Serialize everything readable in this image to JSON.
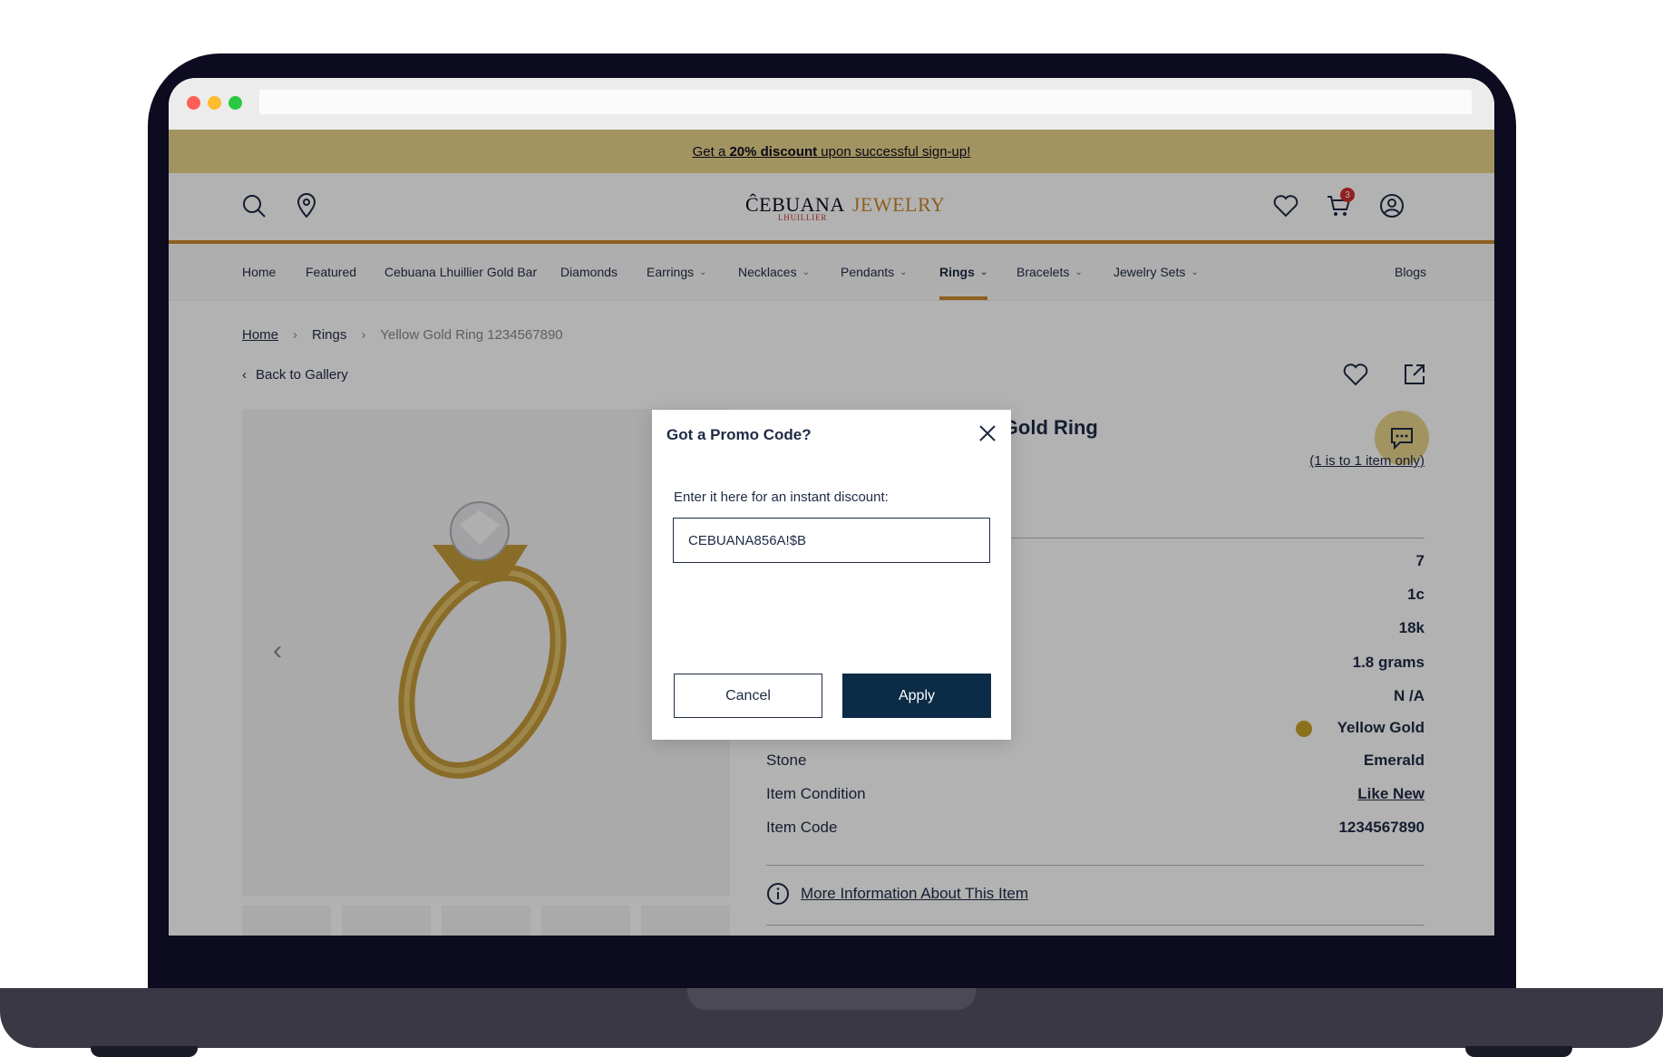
{
  "promo_bar": {
    "prefix": "Get a ",
    "highlight": "20% discount",
    "suffix": " upon successful sign-up!"
  },
  "logo": {
    "brand": "ĈEBUANA",
    "sub": "LHUILLIER",
    "product": "JEWELRY"
  },
  "cart": {
    "count": "3"
  },
  "nav": {
    "items": [
      {
        "label": "Home",
        "dropdown": false
      },
      {
        "label": "Featured",
        "dropdown": false
      },
      {
        "label": "Cebuana Lhuillier Gold Bar",
        "dropdown": false
      },
      {
        "label": "Diamonds",
        "dropdown": false
      },
      {
        "label": "Earrings",
        "dropdown": true
      },
      {
        "label": "Necklaces",
        "dropdown": true
      },
      {
        "label": "Pendants",
        "dropdown": true
      },
      {
        "label": "Rings",
        "dropdown": true,
        "active": true
      },
      {
        "label": "Bracelets",
        "dropdown": true
      },
      {
        "label": "Jewelry Sets",
        "dropdown": true
      }
    ],
    "blogs": "Blogs"
  },
  "breadcrumb": {
    "home": "Home",
    "category": "Rings",
    "current": "Yellow Gold Ring 1234567890"
  },
  "back_link": "Back to Gallery",
  "product": {
    "title_visible": "anite Engagement Yellow Gold Ring",
    "limit_note": "(1 is to 1 item only)",
    "specs_values": [
      "7",
      "1c",
      "18k",
      "1.8 grams",
      "N /A"
    ],
    "color_value": "Yellow Gold",
    "stone_label": "Stone",
    "stone_value": "Emerald",
    "condition_label": "Item Condition",
    "condition_value": "Like New",
    "code_label": "Item Code",
    "code_value": "1234567890",
    "more_info": "More Information About This Item"
  },
  "modal": {
    "title": "Got a Promo Code?",
    "prompt": "Enter it here for an instant discount:",
    "input_value": "CEBUANA856A!$B",
    "cancel_label": "Cancel",
    "apply_label": "Apply"
  },
  "colors": {
    "accent": "#c98a2e",
    "promo_bg": "#e8d48c",
    "navy": "#0c2b46",
    "text": "#1f2a44"
  }
}
